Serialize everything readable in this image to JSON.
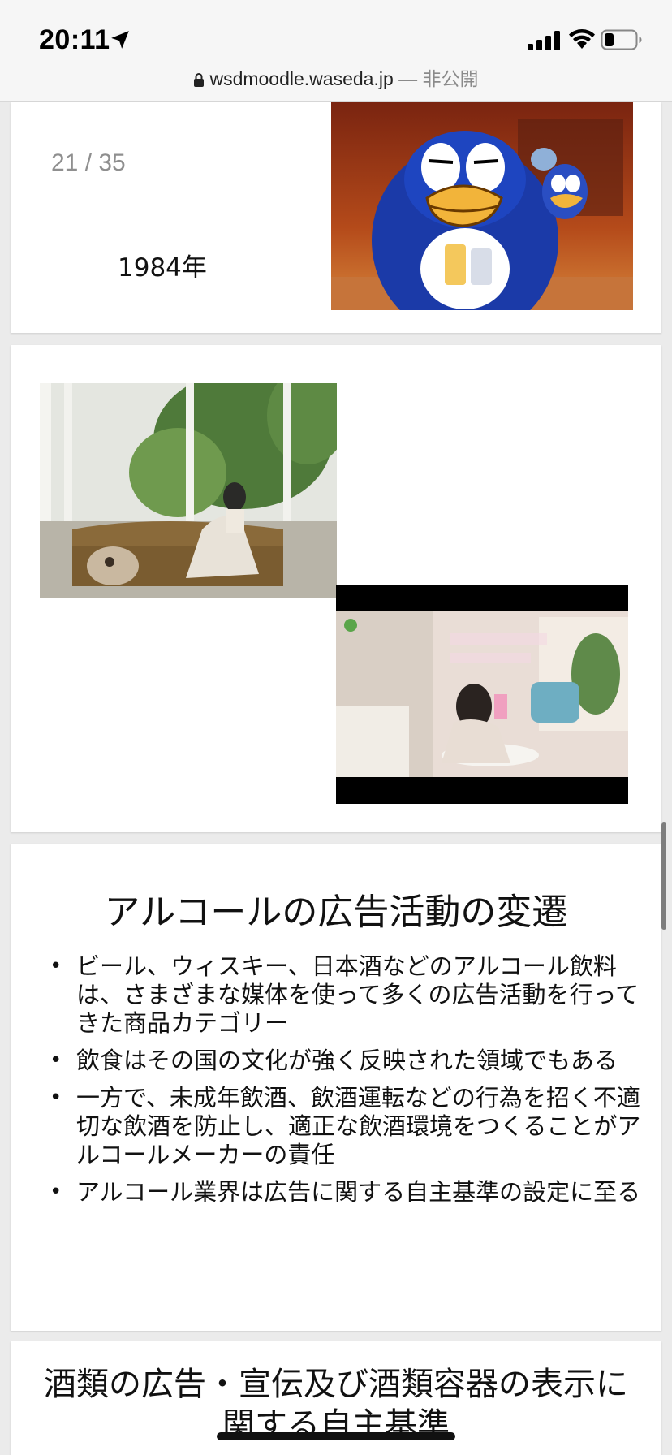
{
  "status_bar": {
    "time": "20:11",
    "url_domain": "wsdmoodle.waseda.jp",
    "url_separator": " — ",
    "url_visibility": "非公開",
    "icons": [
      "location-arrow-icon",
      "cellular-signal-icon",
      "wifi-icon",
      "battery-icon",
      "lock-icon"
    ]
  },
  "slide1": {
    "page_counter": "21 / 35",
    "year_label": "1984年"
  },
  "slide2": {
    "images": [
      "photo-woman-on-sofa-with-dog",
      "photo-woman-commercial-still"
    ]
  },
  "slide3": {
    "title": "アルコールの広告活動の変遷",
    "bullets": [
      "ビール、ウィスキー、日本酒などのアルコール飲料は、さまざまな媒体を使って多くの広告活動を行ってきた商品カテゴリー",
      "飲食はその国の文化が強く反映された領域でもある",
      "一方で、未成年飲酒、飲酒運転などの行為を招く不適切な飲酒を防止し、適正な飲酒環境をつくることがアルコールメーカーの責任",
      "アルコール業界は広告に関する自主基準の設定に至る"
    ]
  },
  "slide4": {
    "title": "酒類の広告・宣伝及び酒類容器の表示に関する自主基準"
  },
  "colors": {
    "page_background": "#ebebeb",
    "slide_background": "#ffffff",
    "status_bar_background": "#f6f6f6",
    "counter_gray": "#8f8f8f"
  }
}
